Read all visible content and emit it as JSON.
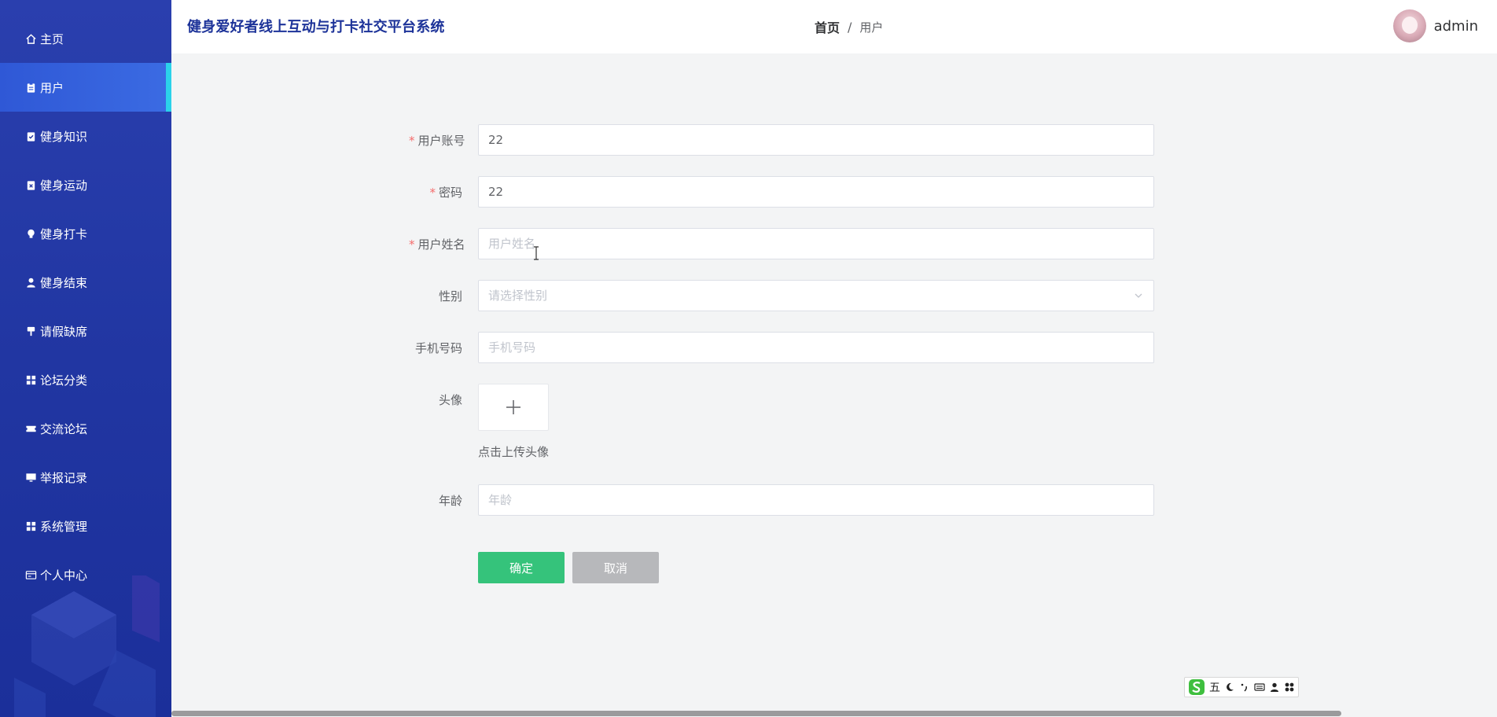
{
  "app": {
    "title": "健身爱好者线上互动与打卡社交平台系统"
  },
  "breadcrumb": {
    "home": "首页",
    "separator": "/",
    "current": "用户"
  },
  "user": {
    "name": "admin"
  },
  "sidebar": {
    "items": [
      {
        "label": "主页",
        "icon": "home-icon"
      },
      {
        "label": "用户",
        "icon": "clipboard-icon",
        "active": true
      },
      {
        "label": "健身知识",
        "icon": "clipboard-check-icon"
      },
      {
        "label": "健身运动",
        "icon": "clipboard-x-icon"
      },
      {
        "label": "健身打卡",
        "icon": "bulb-icon"
      },
      {
        "label": "健身结束",
        "icon": "user-icon"
      },
      {
        "label": "请假缺席",
        "icon": "paint-roller-icon"
      },
      {
        "label": "论坛分类",
        "icon": "grid-icon"
      },
      {
        "label": "交流论坛",
        "icon": "ticket-icon"
      },
      {
        "label": "举报记录",
        "icon": "monitor-icon"
      },
      {
        "label": "系统管理",
        "icon": "grid-icon"
      },
      {
        "label": "个人中心",
        "icon": "id-card-icon"
      }
    ]
  },
  "form": {
    "account": {
      "label": "用户账号",
      "value": "22",
      "required": true
    },
    "password": {
      "label": "密码",
      "value": "22",
      "required": true
    },
    "name": {
      "label": "用户姓名",
      "placeholder": "用户姓名",
      "required": true
    },
    "gender": {
      "label": "性别",
      "placeholder": "请选择性别"
    },
    "phone": {
      "label": "手机号码",
      "placeholder": "手机号码"
    },
    "avatar": {
      "label": "头像",
      "tip": "点击上传头像"
    },
    "age": {
      "label": "年龄",
      "placeholder": "年龄"
    },
    "required_mark": "*",
    "confirm_label": "确定",
    "cancel_label": "取消"
  },
  "ime": {
    "mode": "五"
  },
  "colors": {
    "sidebar": "#2136a2",
    "active_item": "#3b6be3",
    "active_indicator": "#2bd2ea",
    "title": "#1d3399",
    "confirm": "#35c37b",
    "cancel": "#b7b8bb",
    "required": "#f56c6c"
  }
}
